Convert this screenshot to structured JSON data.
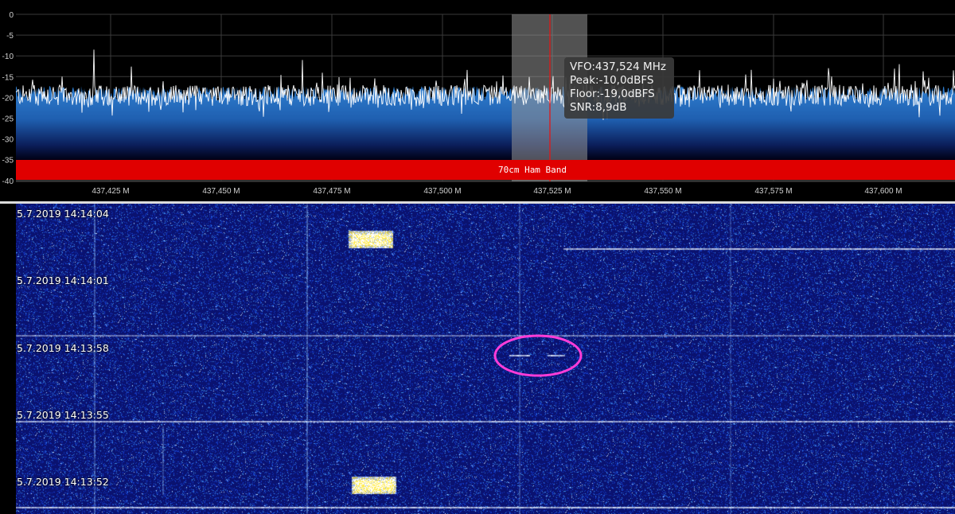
{
  "colors": {
    "band_bar": "#e00000",
    "vfo_line": "#e01818",
    "trace": "#ffffff",
    "spectrum_fill_top": "#2f7fd0",
    "spectrum_fill_bottom": "#000014",
    "waterfall_bg": "#0a0f6e",
    "highlight_ellipse": "#ff3cd8"
  },
  "spectrum": {
    "y_ticks": [
      "0",
      "-5",
      "-10",
      "-15",
      "-20",
      "-25",
      "-30",
      "-35",
      "-40"
    ],
    "freq_ticks": [
      "437,425 M",
      "437,450 M",
      "437,475 M",
      "437,500 M",
      "437,525 M",
      "437,550 M",
      "437,575 M",
      "437,600 M"
    ],
    "band_label": "70cm Ham Band",
    "tooltip": {
      "vfo": "VFO:437,524 MHz",
      "peak": "Peak:-10,0dBFS",
      "floor": "Floor:-19,0dBFS",
      "snr": "SNR:8,9dB"
    }
  },
  "waterfall": {
    "timestamps": [
      "5.7.2019 14:14:04",
      "5.7.2019 14:14:01",
      "5.7.2019 14:13:58",
      "5.7.2019 14:13:55",
      "5.7.2019 14:13:52"
    ]
  }
}
